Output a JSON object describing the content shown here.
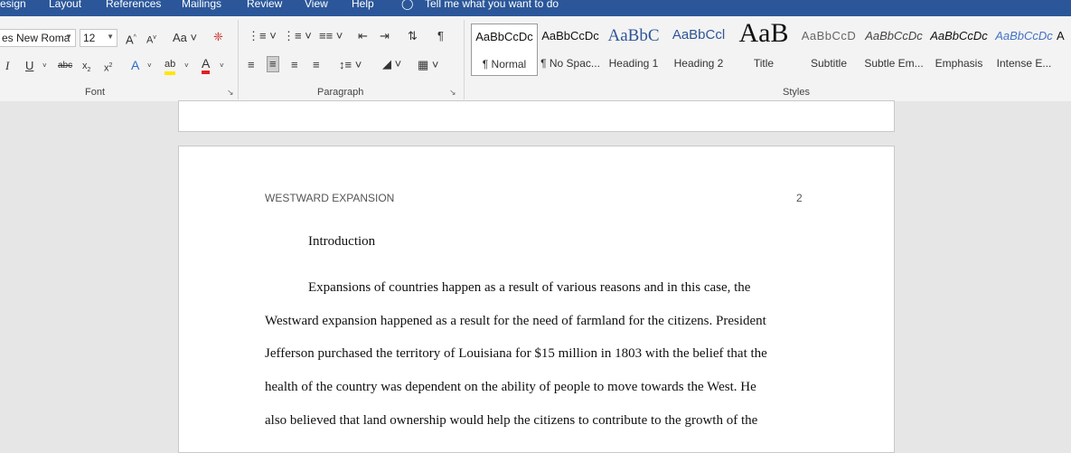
{
  "menubar": {
    "items": [
      "esign",
      "Layout",
      "References",
      "Mailings",
      "Review",
      "View",
      "Help"
    ],
    "tell_me": "Tell me what you want to do"
  },
  "font": {
    "name": "es New Roma",
    "size": "12",
    "group_label": "Font"
  },
  "paragraph": {
    "group_label": "Paragraph"
  },
  "styles": {
    "group_label": "Styles",
    "items": [
      {
        "preview": "AaBbCcDc",
        "name": "¶ Normal"
      },
      {
        "preview": "AaBbCcDc",
        "name": "¶ No Spac..."
      },
      {
        "preview": "AaBbC",
        "name": "Heading 1"
      },
      {
        "preview": "AaBbCcl",
        "name": "Heading 2"
      },
      {
        "preview": "AaB",
        "name": "Title"
      },
      {
        "preview": "AaBbCcD",
        "name": "Subtitle"
      },
      {
        "preview": "AaBbCcDc",
        "name": "Subtle Em..."
      },
      {
        "preview": "AaBbCcDc",
        "name": "Emphasis"
      },
      {
        "preview": "AaBbCcDc",
        "name": "Intense E..."
      },
      {
        "preview": "A",
        "name": ""
      }
    ]
  },
  "document": {
    "running_head": "WESTWARD EXPANSION",
    "page_number": "2",
    "heading": "Introduction",
    "lines": [
      "Expansions of countries happen as a result of various reasons and in this case, the",
      "Westward expansion happened as a result for the need of farmland for the citizens.  President",
      "Jefferson purchased the territory of Louisiana for $15 million in 1803 with the belief that the",
      "health of the country was dependent on the ability of people to move towards the West. He",
      "also believed that land ownership would help the citizens to contribute to the growth of the"
    ]
  },
  "colors": {
    "accent": "#2b579a",
    "ribbon_bg": "#f3f3f3",
    "canvas_bg": "#e6e6e6",
    "heading_blue": "#2e5597"
  }
}
